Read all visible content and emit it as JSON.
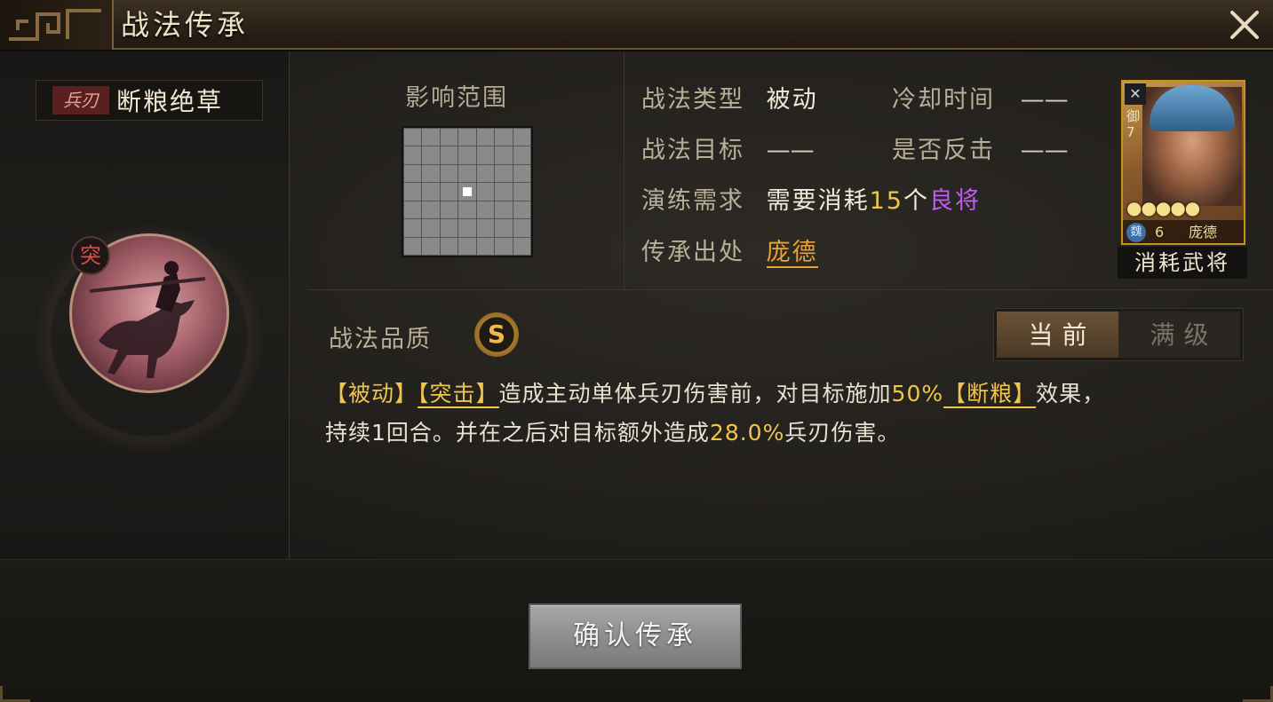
{
  "header": {
    "title": "战法传承"
  },
  "skill": {
    "type_badge": "兵刃",
    "name": "断粮绝草",
    "raid_marker": "突"
  },
  "range": {
    "label": "影响范围",
    "grid_size": 7,
    "active_cell": [
      3,
      3
    ]
  },
  "info": {
    "type_label": "战法类型",
    "type_value": "被动",
    "cooldown_label": "冷却时间",
    "cooldown_value": "——",
    "target_label": "战法目标",
    "target_value": "——",
    "counter_label": "是否反击",
    "counter_value": "——",
    "train_label": "演练需求",
    "train_prefix": "需要消耗",
    "train_count": "15",
    "train_unit": "个",
    "train_item": "良将",
    "origin_label": "传承出处",
    "origin_value": "庞德"
  },
  "general_card": {
    "type_icon": "✕",
    "role": "御7",
    "stars": "●●●●●",
    "faction": "魏",
    "cost": "6",
    "name": "庞德",
    "caption": "消耗武将"
  },
  "quality": {
    "label": "战法品质",
    "grade": "S"
  },
  "level_toggle": {
    "current": "当前",
    "max": "满级"
  },
  "description": {
    "tag1": "【被动】",
    "tag2": "【突击】",
    "text1": "造成主动单体兵刃伤害前，对目标施加",
    "num1": "50%",
    "tag3": "【断粮】",
    "text2": "效果，",
    "text3": "持续1回合。并在之后对目标额外造成",
    "num2": "28.0%",
    "text4": "兵刃伤害。"
  },
  "footer": {
    "confirm_label": "确认传承"
  },
  "colors": {
    "gold": "#f0c54a",
    "purple": "#c25cf0",
    "orange": "#eca234",
    "badge_red": "#5a1f1f"
  }
}
